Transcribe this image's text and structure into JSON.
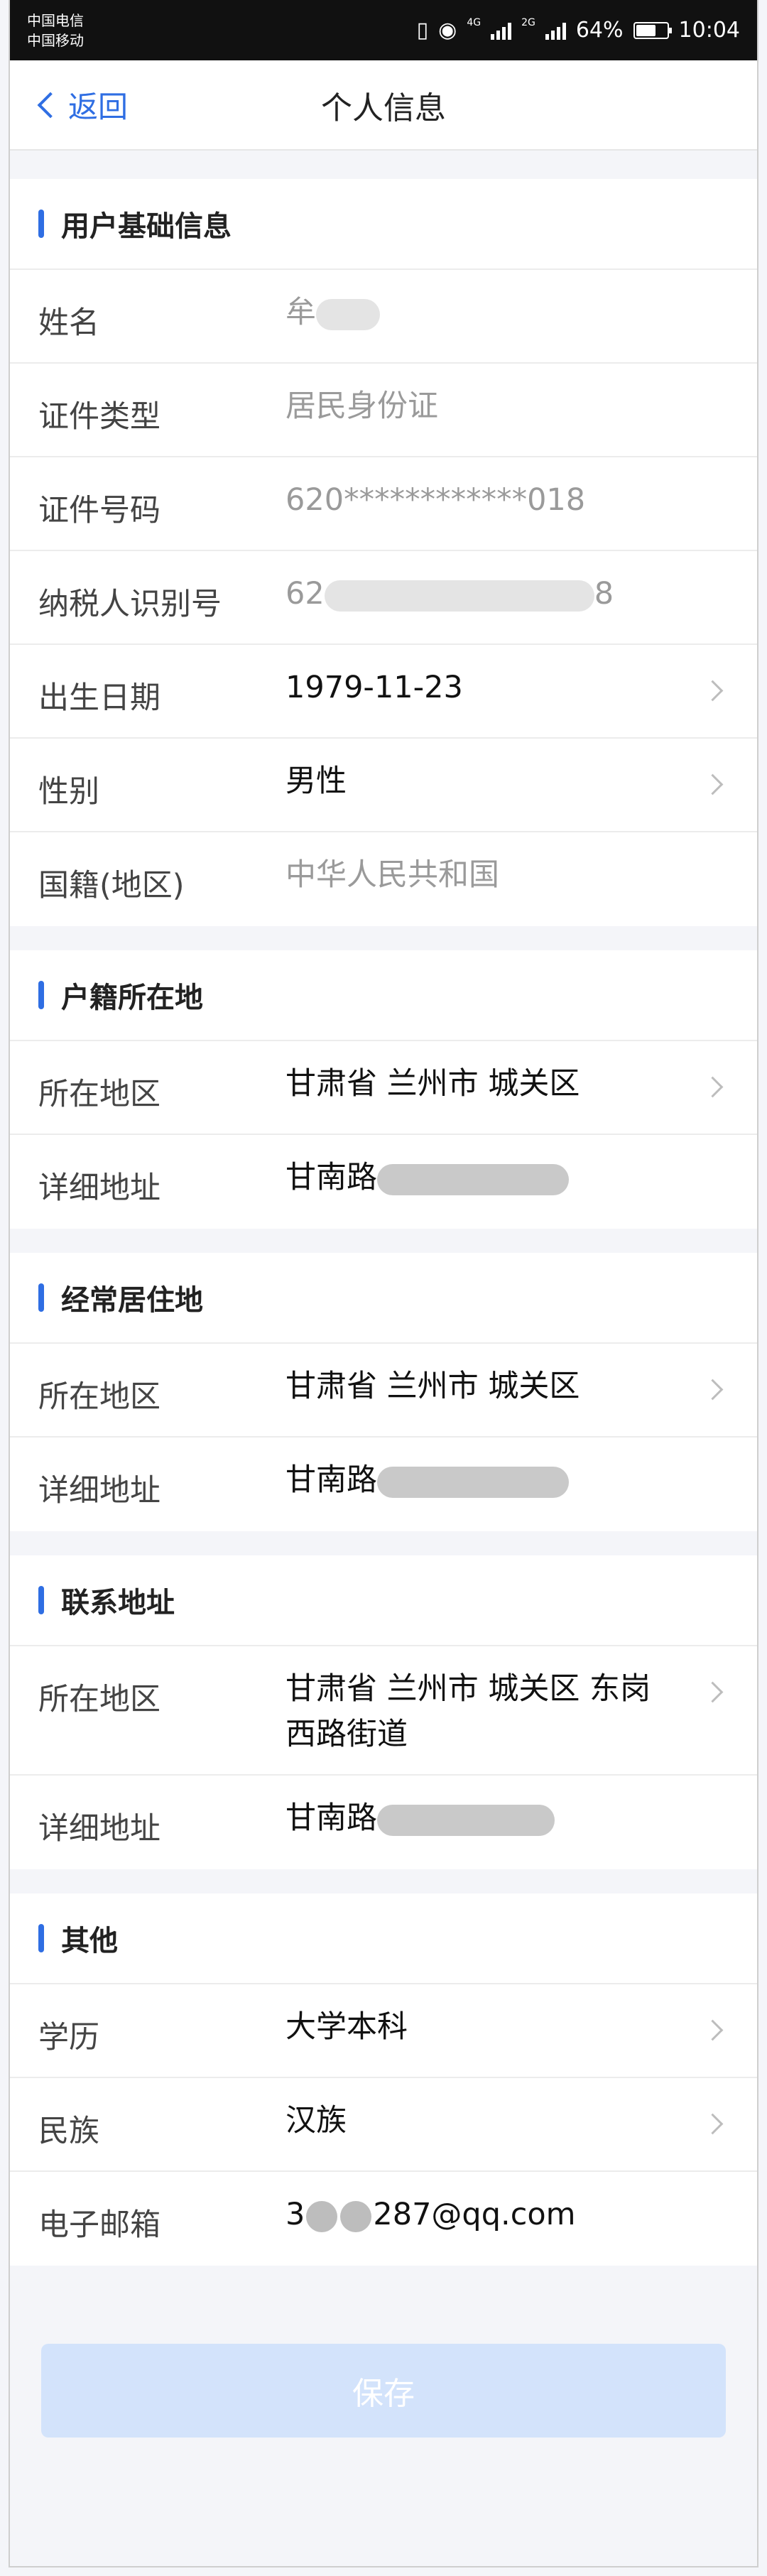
{
  "status": {
    "carrier1": "中国电信",
    "carrier2": "中国移动",
    "net1": "4G",
    "net2": "2G",
    "battery": "64%",
    "battery_level": 0.64,
    "time": "10:04"
  },
  "nav": {
    "back_label": "返回",
    "title": "个人信息"
  },
  "basic": {
    "title": "用户基础信息",
    "name_label": "姓名",
    "name_value": "牟",
    "idtype_label": "证件类型",
    "idtype_value": "居民身份证",
    "idno_label": "证件号码",
    "idno_value": "620************018",
    "taxid_label": "纳税人识别号",
    "taxid_prefix": "62",
    "taxid_suffix": "8",
    "birth_label": "出生日期",
    "birth_value": "1979-11-23",
    "gender_label": "性别",
    "gender_value": "男性",
    "nation_label": "国籍(地区)",
    "nation_value": "中华人民共和国"
  },
  "household": {
    "title": "户籍所在地",
    "region_label": "所在地区",
    "region_value": "甘肃省 兰州市 城关区",
    "address_label": "详细地址",
    "address_value": "甘南路"
  },
  "residence": {
    "title": "经常居住地",
    "region_label": "所在地区",
    "region_value": "甘肃省 兰州市 城关区",
    "address_label": "详细地址",
    "address_value": "甘南路"
  },
  "contact": {
    "title": "联系地址",
    "region_label": "所在地区",
    "region_value": "甘肃省 兰州市 城关区 东岗西路街道",
    "address_label": "详细地址",
    "address_value": "甘南路"
  },
  "other": {
    "title": "其他",
    "edu_label": "学历",
    "edu_value": "大学本科",
    "ethnic_label": "民族",
    "ethnic_value": "汉族",
    "email_label": "电子邮箱",
    "email_prefix": "3",
    "email_suffix": "287@qq.com"
  },
  "save_label": "保存"
}
